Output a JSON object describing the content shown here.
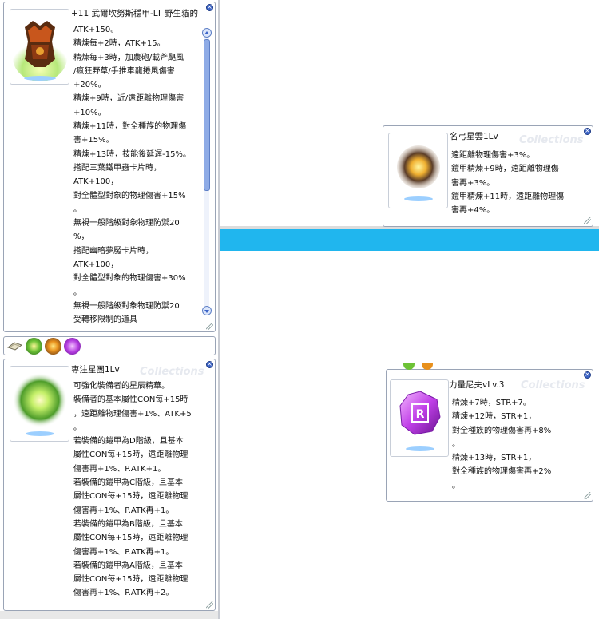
{
  "windows": {
    "armor": {
      "title": "+11 武爾坎努斯穩甲-LT 野生貓的",
      "lines": [
        "ATK+150。",
        "精煉每+2時，ATK+15。",
        "精煉每+3時，加農砲/載斧颶風",
        "/瘋狂野草/手推車龍捲風傷害",
        "+20%。",
        "精煉+9時，近/遠距離物理傷害",
        "+10%。",
        "精煉+11時，對全種族的物理傷",
        "害+15%。",
        "精煉+13時，技能後延遲-15%。",
        "搭配三葉鐵甲蟲卡片時，",
        "ATK+100，",
        "對全體型對象的物理傷害+15%",
        "。",
        "無視一般階級對象物理防禦20",
        "%，",
        "搭配幽暗夢魘卡片時，",
        "ATK+100，",
        "對全體型對象的物理傷害+30%",
        "。",
        "無視一般階級對象物理防禦20",
        "受轉移限制的道具"
      ]
    },
    "star_cloud": {
      "title": "名弓星雲1Lv",
      "watermark": "Collections",
      "lines": [
        "遠距離物理傷害+3%。",
        "鎧甲精煉+9時，遠距離物理傷",
        "害再+3%。",
        "鎧甲精煉+11時，遠距離物理傷",
        "害再+4%。"
      ]
    },
    "focus_nebula": {
      "title": "專注星團1Lv",
      "watermark": "Collections",
      "lines": [
        "可強化裝備者的星辰精華。",
        "裝備者的基本屬性CON每+15時",
        "，遠距離物理傷害+1%、ATK+5",
        "。",
        "若裝備的鎧甲為D階級，且基本",
        "屬性CON每+15時，遠距離物理",
        "傷害再+1%、P.ATK+1。",
        "若裝備的鎧甲為C階級，且基本",
        "屬性CON每+15時，遠距離物理",
        "傷害再+1%、P.ATK再+1。",
        "若裝備的鎧甲為B階級，且基本",
        "屬性CON每+15時，遠距離物理",
        "傷害再+1%、P.ATK再+1。",
        "若裝備的鎧甲為A階級，且基本",
        "屬性CON每+15時，遠距離物理",
        "傷害再+1%、P.ATK再+2。"
      ]
    },
    "power_rune": {
      "title": "力量尼夫vLv.3",
      "watermark": "Collections",
      "lines": [
        "精煉+7時，STR+7。",
        "精煉+12時，STR+1，",
        "對全種族的物理傷害再+8%",
        "。",
        "精煉+13時，STR+1，",
        "對全種族的物理傷害再+2%",
        "。"
      ]
    }
  },
  "sockets": [
    {
      "icon": "slot-card-icon"
    },
    {
      "icon": "green-nebula-icon"
    },
    {
      "icon": "star-cloud-icon"
    },
    {
      "icon": "purple-rune-icon"
    }
  ],
  "colors": {
    "accent_bar": "#20b6ee",
    "window_border": "#9aa4b6",
    "close_button": "#3c64c8"
  }
}
